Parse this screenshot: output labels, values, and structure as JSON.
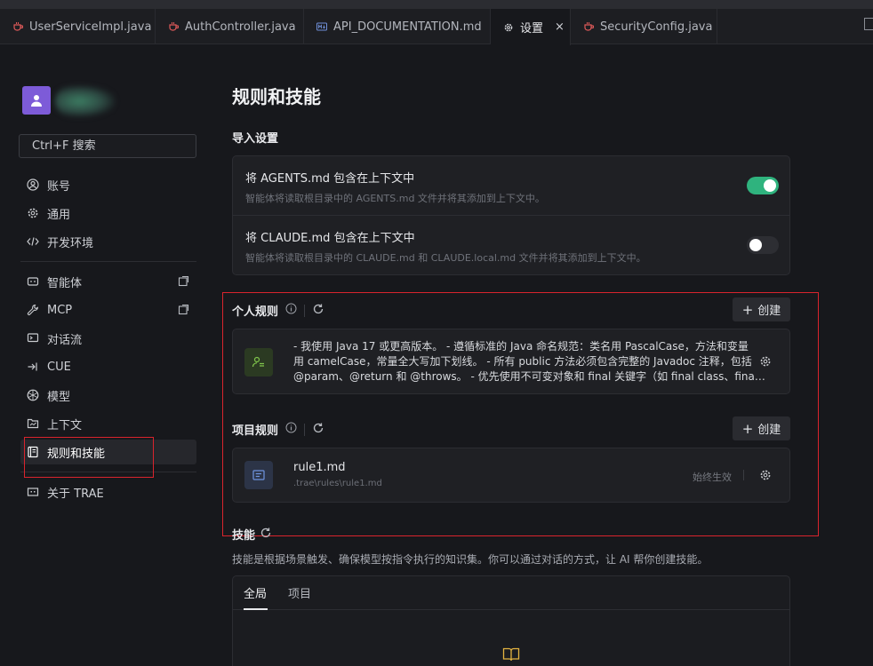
{
  "tabs": [
    {
      "label": "UserServiceImpl.java",
      "icon": "java-file-icon"
    },
    {
      "label": "AuthController.java",
      "icon": "java-file-icon"
    },
    {
      "label": "API_DOCUMENTATION.md",
      "icon": "markdown-file-icon"
    },
    {
      "label": "设置",
      "icon": "gear-icon",
      "active": true
    },
    {
      "label": "SecurityConfig.java",
      "icon": "java-file-icon"
    }
  ],
  "tab_close": "×",
  "sidebar": {
    "search_placeholder": "Ctrl+F 搜索",
    "items": [
      {
        "label": "账号"
      },
      {
        "label": "通用"
      },
      {
        "label": "开发环境"
      },
      {
        "label": "智能体"
      },
      {
        "label": "MCP"
      },
      {
        "label": "对话流"
      },
      {
        "label": "CUE"
      },
      {
        "label": "模型"
      },
      {
        "label": "上下文"
      },
      {
        "label": "规则和技能"
      },
      {
        "label": "关于 TRAE"
      }
    ]
  },
  "main": {
    "title": "规则和技能",
    "import": {
      "heading": "导入设置",
      "agents_title": "将 AGENTS.md 包含在上下文中",
      "agents_desc": "智能体将读取根目录中的 AGENTS.md 文件并将其添加到上下文中。",
      "claude_title": "将 CLAUDE.md 包含在上下文中",
      "claude_desc": "智能体将读取根目录中的 CLAUDE.md 和 CLAUDE.local.md 文件并将其添加到上下文中。"
    },
    "personal": {
      "heading": "个人规则",
      "create": "创建",
      "rule_line1": "- 我使用 Java 17 或更高版本。 - 遵循标准的 Java 命名规范：类名用 PascalCase，方法和变量",
      "rule_line2": "用 camelCase，常量全大写加下划线。 - 所有 public 方法必须包含完整的 Javadoc 注释，包括",
      "rule_line3": "@param、@return 和 @throws。 - 优先使用不可变对象和 final 关键字（如 final class、fina…"
    },
    "project": {
      "heading": "项目规则",
      "create": "创建",
      "rule_name": "rule1.md",
      "rule_path": ".trae\\rules\\rule1.md",
      "rule_status": "始终生效"
    },
    "skills": {
      "heading": "技能",
      "desc": "技能是根据场景触发、确保模型按指令执行的知识集。你可以通过对话的方式，让 AI 帮你创建技能。",
      "tab_global": "全局",
      "tab_project": "项目"
    }
  },
  "colors": {
    "accent_green": "#2fb37e",
    "highlight_red": "#d9242d",
    "avatar": "#7d5bd8"
  }
}
